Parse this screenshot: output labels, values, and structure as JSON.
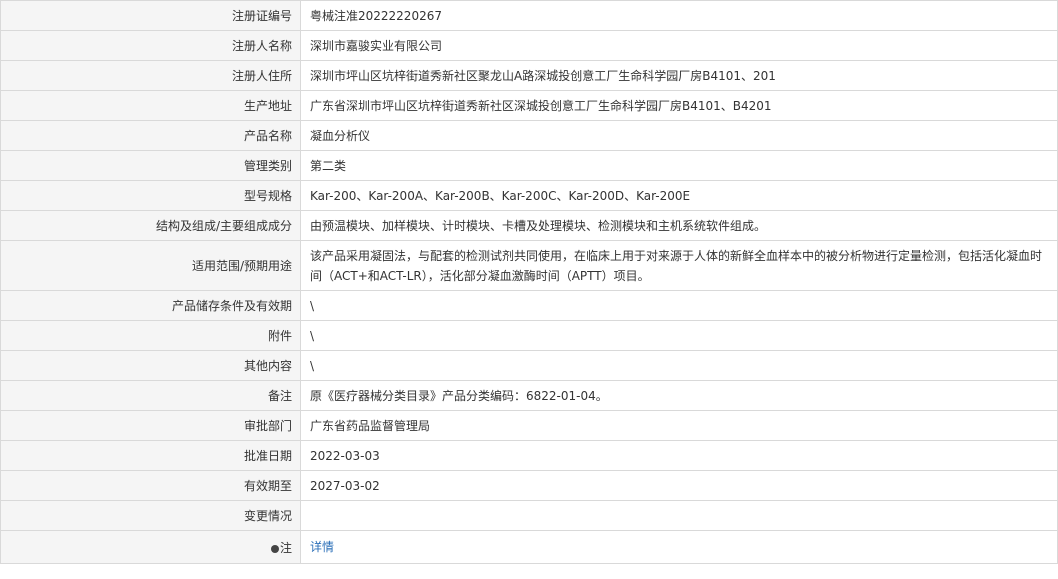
{
  "rows": [
    {
      "label": "注册证编号",
      "value": "粤械注准20222220267"
    },
    {
      "label": "注册人名称",
      "value": "深圳市嘉骏实业有限公司"
    },
    {
      "label": "注册人住所",
      "value": "深圳市坪山区坑梓街道秀新社区聚龙山A路深城投创意工厂生命科学园厂房B4101、201"
    },
    {
      "label": "生产地址",
      "value": "广东省深圳市坪山区坑梓街道秀新社区深城投创意工厂生命科学园厂房B4101、B4201"
    },
    {
      "label": "产品名称",
      "value": "凝血分析仪"
    },
    {
      "label": "管理类别",
      "value": "第二类"
    },
    {
      "label": "型号规格",
      "value": "Kar-200、Kar-200A、Kar-200B、Kar-200C、Kar-200D、Kar-200E"
    },
    {
      "label": "结构及组成/主要组成成分",
      "value": "由预温模块、加样模块、计时模块、卡槽及处理模块、检测模块和主机系统软件组成。"
    },
    {
      "label": "适用范围/预期用途",
      "value": "该产品采用凝固法，与配套的检测试剂共同使用，在临床上用于对来源于人体的新鲜全血样本中的被分析物进行定量检测，包括活化凝血时间（ACT+和ACT-LR），活化部分凝血激酶时间（APTT）项目。"
    },
    {
      "label": "产品储存条件及有效期",
      "value": "\\"
    },
    {
      "label": "附件",
      "value": "\\"
    },
    {
      "label": "其他内容",
      "value": "\\"
    },
    {
      "label": "备注",
      "value": "原《医疗器械分类目录》产品分类编码：6822-01-04。"
    },
    {
      "label": "审批部门",
      "value": "广东省药品监督管理局"
    },
    {
      "label": "批准日期",
      "value": "2022-03-03"
    },
    {
      "label": "有效期至",
      "value": "2027-03-02"
    },
    {
      "label": "变更情况",
      "value": ""
    }
  ],
  "note": {
    "icon": "lightbulb-icon",
    "label": "注",
    "link_text": "详情",
    "link_color": "#2b6fb8"
  }
}
